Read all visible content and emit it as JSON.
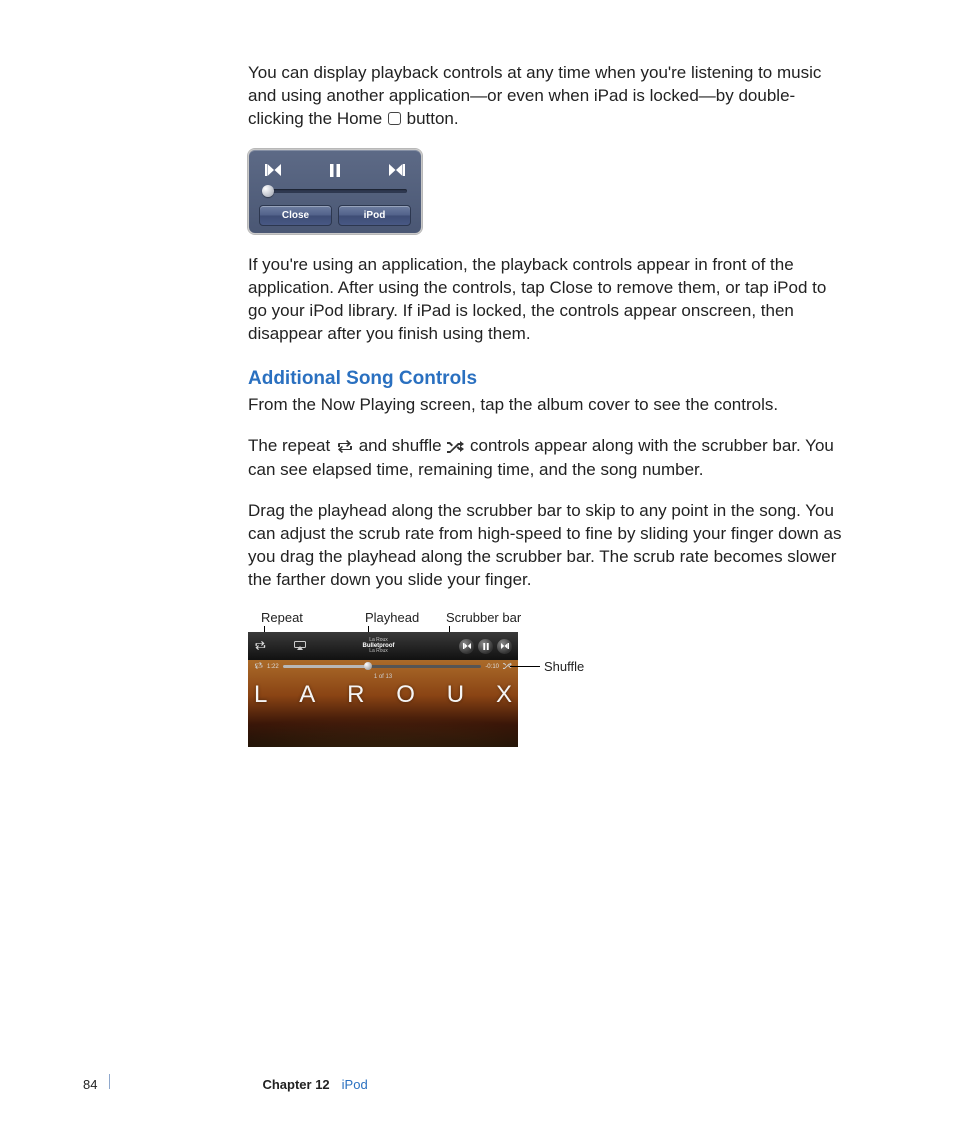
{
  "paragraphs": {
    "p1a": "You can display playback controls at any time when you're listening to music and using another application—or even when iPad is locked—by double-clicking the Home ",
    "p1b": " button.",
    "p2": "If you're using an application, the playback controls appear in front of the application. After using the controls, tap Close to remove them, or tap iPod to go your iPod library. If iPad is locked, the controls appear onscreen, then disappear after you finish using them.",
    "heading": "Additional Song Controls",
    "p3": "From the Now Playing screen, tap the album cover to see the controls.",
    "p4a": "The repeat ",
    "p4b": " and shuffle ",
    "p4c": " controls appear along with the scrubber bar. You can see elapsed time, remaining time, and the song number.",
    "p5": "Drag the playhead along the scrubber bar to skip to any point in the song. You can adjust the scrub rate from high-speed to fine by sliding your finger down as you drag the playhead along the scrubber bar. The scrub rate becomes slower the farther down you slide your finger."
  },
  "popup": {
    "close_label": "Close",
    "ipod_label": "iPod"
  },
  "diagram_labels": {
    "repeat": "Repeat",
    "playhead": "Playhead",
    "scrubber": "Scrubber bar",
    "shuffle": "Shuffle"
  },
  "player": {
    "artist": "La Roux",
    "title": "Bulletproof",
    "album": "La Roux",
    "elapsed": "1:22",
    "remaining": "-0:10",
    "song_number": "1 of 13",
    "letters": [
      "L",
      "A",
      "R",
      "O",
      "U",
      "X"
    ]
  },
  "footer": {
    "page": "84",
    "chapter_label": "Chapter 12",
    "chapter_name": "iPod"
  }
}
